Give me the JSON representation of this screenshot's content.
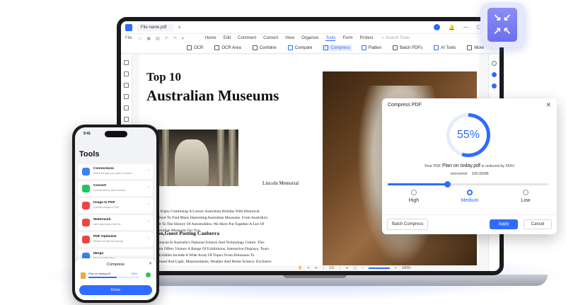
{
  "window": {
    "tab_title": "File name.pdf",
    "tab_add": "+"
  },
  "menubar": {
    "file": "File",
    "menus": [
      "Home",
      "Edit",
      "Comment",
      "Convert",
      "View",
      "Organize",
      "Tools",
      "Form",
      "Protect"
    ],
    "active_menu": "Tools",
    "search_placeholder": "Search Tools"
  },
  "toolbar": {
    "items": [
      {
        "label": "OCR",
        "icon": "ocr-icon"
      },
      {
        "label": "OCR Area",
        "icon": "ocr-area-icon"
      },
      {
        "label": "Combine",
        "icon": "combine-icon"
      },
      {
        "label": "Compare",
        "icon": "compare-icon"
      },
      {
        "label": "Compress",
        "icon": "compress-icon",
        "selected": true
      },
      {
        "label": "Flatten",
        "icon": "flatten-icon"
      },
      {
        "label": "Batch PDFs",
        "icon": "batch-icon"
      },
      {
        "label": "AI Tools",
        "icon": "ai-icon"
      },
      {
        "label": "More",
        "icon": "more-icon"
      }
    ]
  },
  "document": {
    "heading_line1": "Top 10",
    "heading_line2": "Australian Museums",
    "image_caption": "Lincoln Memorial",
    "byline": "Cooke",
    "paragraph1_lines": [
      "ers Who Enjoy Combining A Luxury Australian Holiday With Historical",
      "ion Are Sure To Find Many Interesting Australian Museums. From Australia's",
      "ing Spirit To The History Of Automobiles. We Have Put Together A List Of",
      "p 10 Australian Museums For You."
    ],
    "subheading": "estacon,Guest Posting Canberra",
    "paragraph2_lines": [
      "ra's Questacon Is Australia's National Science And Technology Centre. This",
      "h Museum Offers Visitors A Range Of Exhibitions, Interactive Displays, Tours",
      "tivities. Exhibits Include A Wide Array Of Topics From Dinosaurs To",
      "raphy, Sound And Light, Measurements, Weather And Home Science. Exclusive"
    ]
  },
  "status_bar": {
    "page": "1/1",
    "zoom": "100%"
  },
  "compress_dialog": {
    "title": "Compress PDF",
    "percent_label": "55%",
    "percent_value": 0.55,
    "reduced_prefix": "Your PDF",
    "file_name": "Plan on today.pdf",
    "reduced_suffix": "is reduced by 55%!",
    "old_size": "200.00KB",
    "new_size": "100.00KB",
    "slider_value": 0.37,
    "options": [
      "High",
      "Medium",
      "Low"
    ],
    "selected_option": "Medium",
    "batch_label": "Batch Compress",
    "apply_label": "Apply",
    "cancel_label": "Cancel"
  },
  "phone": {
    "time": "9:41",
    "title": "Tools",
    "items": [
      {
        "title": "Connections",
        "subtitle": "Select the type you want to convert",
        "color": "#3b82f6",
        "icon": "connections-icon"
      },
      {
        "title": "Convert",
        "subtitle": "Convert files to other formats",
        "color": "#22c55e",
        "icon": "convert-icon"
      },
      {
        "title": "Image to PDF",
        "subtitle": "Convert images to PDF",
        "color": "#ef4444",
        "icon": "image-to-pdf-icon"
      },
      {
        "title": "Watermark",
        "subtitle": "Add watermark to the file",
        "color": "#ef4444",
        "icon": "watermark-icon"
      },
      {
        "title": "PDF Optimizer",
        "subtitle": "Reduce the file size quickly",
        "color": "#ef4444",
        "icon": "optimizer-icon"
      },
      {
        "title": "Merge",
        "subtitle": "Merge multiple files",
        "color": "#3b82f6",
        "icon": "merge-icon"
      }
    ],
    "sheet": {
      "title": "Compress",
      "file_name": "Plan on today.pdf",
      "percent": "55%",
      "progress": 0.55,
      "done_label": "Done"
    }
  },
  "colors": {
    "accent": "#2f6bff",
    "success": "#28c160"
  }
}
